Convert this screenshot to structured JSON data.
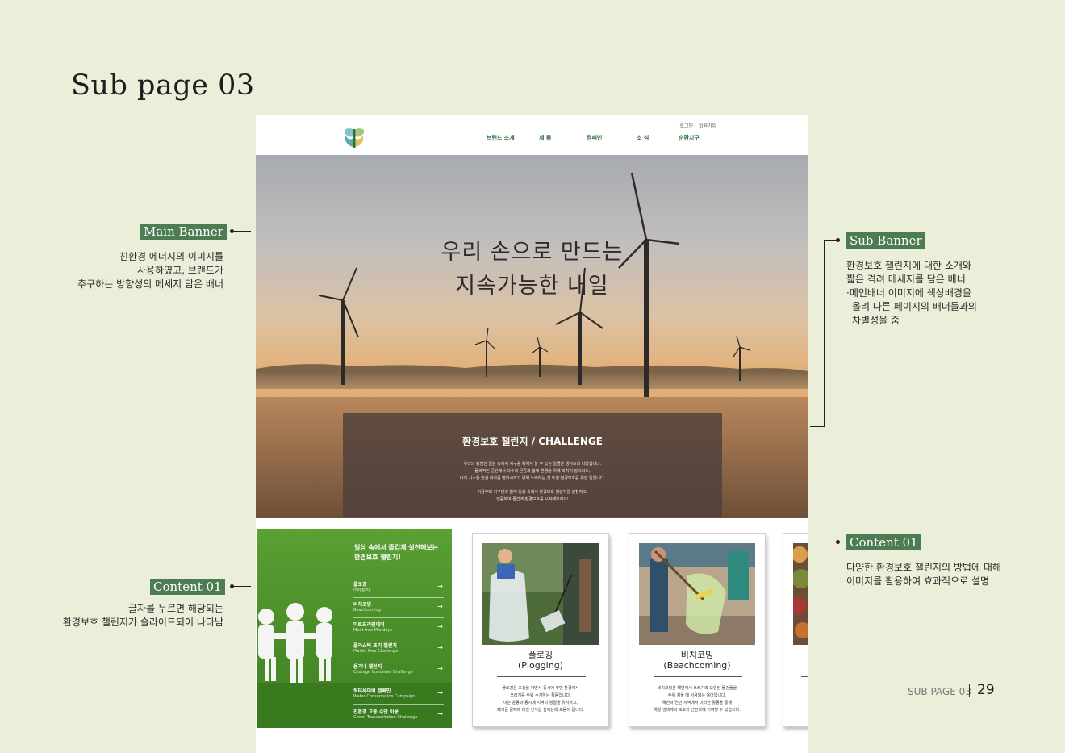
{
  "page_heading": "Sub page 03",
  "annotations": {
    "main_banner": {
      "tag": "Main Banner",
      "lines": [
        "친환경 에너지의 이미지를",
        "사용하였고,  브랜드가",
        "추구하는 방향성의 메세지 담은 배너"
      ]
    },
    "sub_banner": {
      "tag": "Sub Banner",
      "lines": [
        "환경보호 챌린지에 대한 소개와",
        "짧은 격려 메세지를 담은 배너",
        "·메인배너 이미지에 색상배경을",
        "올려 다른 페이지의 배너들과의",
        "차별성을 줌"
      ]
    },
    "content_left": {
      "tag": "Content 01",
      "lines": [
        "글자를 누르면 해당되는",
        "환경보호 챌린지가 슬라이드되어 나타남"
      ]
    },
    "content_right": {
      "tag": "Content 01",
      "lines": [
        "다양한 환경보호 챌린지의 방법에 대해",
        "이미지를 활용하여 효과적으로 설명"
      ]
    }
  },
  "site": {
    "util": {
      "login": "로그인",
      "join": "회원가입"
    },
    "nav": [
      "브랜드 소개",
      "제 품",
      "캠페인",
      "소 식",
      "순환지구"
    ],
    "banner": {
      "title_line1": "우리 손으로 만드는",
      "title_line2": "지속가능한 내일",
      "sub_title": "환경보호 챌린지 / CHALLENGE",
      "sub_lines": [
        "우리의 평범한 일상 속에서 지구를 위해서 할 수 있는 일들은 생각보다 다양합니다.",
        "물리적인 공간에서 다수의 군중과 함께 환경을 위해 외치지 않더라도,",
        "나의 사소한 습관 하나를 변화시키기 위해 노력하는 것 또한 환경보호를 위한 일입니다.",
        "지금부터 지구단과 함께 일상 속에서 환경보호 챌린지를 실천하고,",
        "인증하여 즐겁게 환경보호를 시작해보아요!"
      ]
    },
    "challenge_panel": {
      "title_line1": "일상 속에서 즐겁게 실천해보는",
      "title_line2": "환경보호 챌린지!",
      "items": [
        {
          "ko": "플로깅",
          "en": "Plogging"
        },
        {
          "ko": "비치코밍",
          "en": "Beachcoming"
        },
        {
          "ko": "미트프리먼데이",
          "en": "Meat-free Mondays"
        },
        {
          "ko": "플라스틱 프리 챌린지",
          "en": "Plastic-Free Challenge"
        },
        {
          "ko": "용기내 챌린지",
          "en": "Courage Container Challenge"
        },
        {
          "ko": "워터세이버 캠페인",
          "en": "Water Conservation Campaign"
        },
        {
          "ko": "친환경 교통 수단 이용",
          "en": "Green Transportation Challenge"
        }
      ],
      "arrow": "→"
    },
    "cards": [
      {
        "title_ko": "플로깅",
        "title_en": "(Plogging)",
        "lines": [
          "플로깅은 조깅을 하면서 동시에 주변 환경에서",
          "쓰레기를 주워 수거하는 활동입니다.",
          "이는 운동과 동시에 지역의 청결을 유지하고,",
          "폐기물 문제에 대한 인식을 높이는데 도움이 됩니다."
        ]
      },
      {
        "title_ko": "비치코밍",
        "title_en": "(Beachcoming)",
        "lines": [
          "비치코밍은 해변에서 쓰레기와 오염된 물건들을",
          "주워 치울 때 사용되는 용어입니다.",
          "해변과 연안 지역에서 이러한 활동을 통해",
          "해양 생태계의 보호와 선진화에 기여할 수 있습니다."
        ]
      }
    ]
  },
  "footer": {
    "label": "SUB PAGE 03",
    "page_number": "29"
  }
}
